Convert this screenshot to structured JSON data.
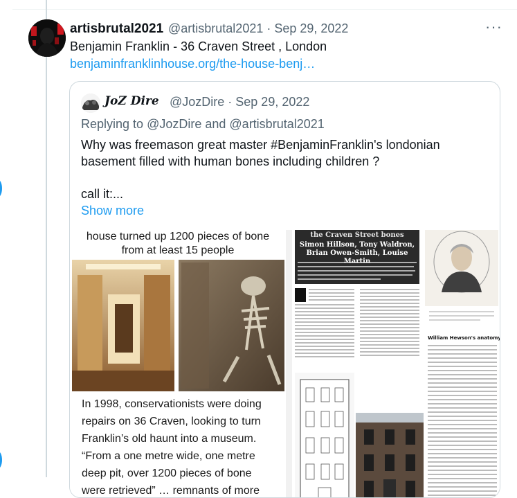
{
  "tweet": {
    "author_name": "artisbrutal2021",
    "author_handle_date": "@artisbrutal2021 · Sep 29, 2022",
    "more_icon": "more-horizontal-icon",
    "text": "Benjamin Franklin - 36 Craven Street , London",
    "link": "benjaminfranklinhouse.org/the-house-benj…"
  },
  "quote": {
    "author_name": "JoZ Dire",
    "author_handle_date": "@JozDire · Sep 29, 2022",
    "replying_prefix": "Replying to ",
    "replying_to_1": "@JozDire",
    "replying_and": " and ",
    "replying_to_2": "@artisbrutal2021",
    "text_line1": "Why was freemason great master #BenjaminFranklin's londonian",
    "text_line2": "basement filled with human bones including children ?",
    "text_line3": "call it:...",
    "show_more": "Show more"
  },
  "media_left": {
    "caption_line1": "house turned up 1200 pieces of bone",
    "caption_line2": "from at least 15 people",
    "body_lines": [
      "In 1998, conservationists were doing",
      "repairs on 36 Craven, looking to turn",
      "Franklin’s old haunt into a museum.",
      "“From a one metre wide, one metre",
      "deep pit, over 1200 pieces of bone",
      "were retrieved” … remnants of more"
    ]
  },
  "media_right": {
    "title_line1": "the Craven Street bones",
    "authors_line1": "Simon Hillson, Tony Waldron,",
    "authors_line2": "Brian Owen-Smith, Louise Martin",
    "subhead": "William Hewson's anatomy school"
  },
  "colors": {
    "accent": "#1d9bf0",
    "secondary_text": "#536471",
    "border": "#cfd9de"
  }
}
